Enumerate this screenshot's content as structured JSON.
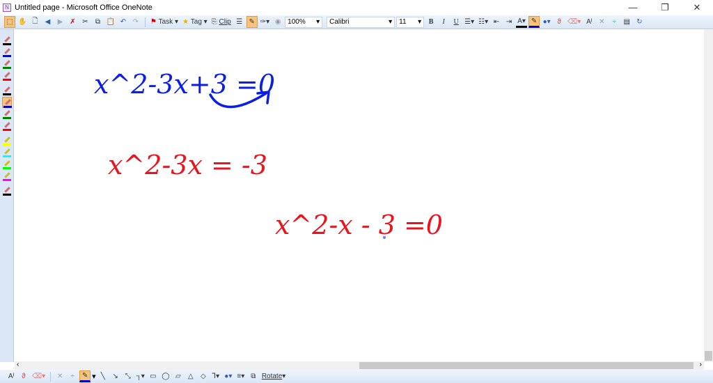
{
  "window": {
    "title": "Untitled page - Microsoft Office OneNote",
    "minimize": "—",
    "restore": "❐",
    "close": "✕"
  },
  "toolbar": {
    "task": "Task",
    "tag": "Tag",
    "clip": "Clip",
    "zoom": "100%",
    "font": "Calibri",
    "size": "11",
    "bold": "B",
    "italic": "I",
    "underline": "U"
  },
  "pens": [
    {
      "color": "#000000",
      "type": "pen"
    },
    {
      "color": "#0000ff",
      "type": "pen"
    },
    {
      "color": "#008000",
      "type": "pen"
    },
    {
      "color": "#ff0000",
      "type": "pen"
    },
    {
      "color": "#000000",
      "type": "pen"
    },
    {
      "color": "#0000cc",
      "type": "pen",
      "selected": true
    },
    {
      "color": "#008000",
      "type": "pen"
    },
    {
      "color": "#ff0000",
      "type": "pen"
    },
    {
      "color": "#ffff00",
      "type": "highlighter"
    },
    {
      "color": "#00ffff",
      "type": "highlighter"
    },
    {
      "color": "#00ff00",
      "type": "highlighter"
    },
    {
      "color": "#ff00ff",
      "type": "highlighter"
    },
    {
      "color": "#000000",
      "type": "pen"
    }
  ],
  "ink": {
    "line1": "x^2-3x+3 =0",
    "line2": "x^2-3x = -3",
    "line3": "x^2-x - 3 =0",
    "line1_color": "#0a1ee6",
    "red": "#e8141e"
  },
  "bottom": {
    "rotate": "Rotate"
  }
}
